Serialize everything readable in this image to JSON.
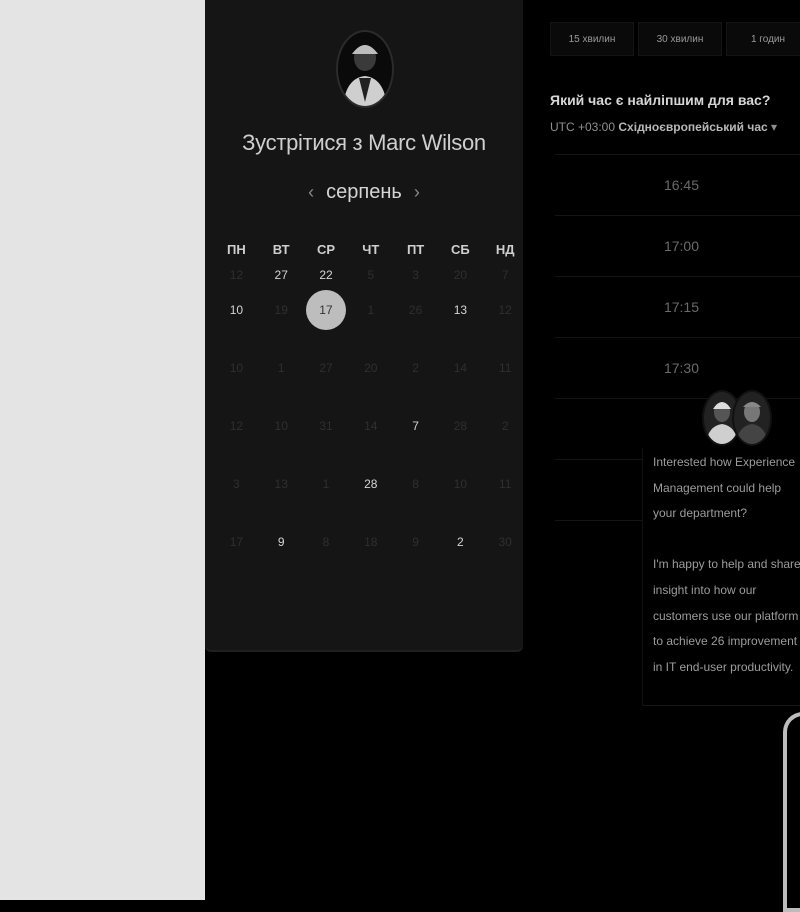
{
  "calendar": {
    "title": "Зустрітися з Marc Wilson",
    "month": "серпень",
    "prev": "‹",
    "next": "›",
    "weekdays": [
      "ПН",
      "ВТ",
      "СР",
      "ЧТ",
      "ПТ",
      "СБ",
      "НД"
    ],
    "weeks": [
      [
        [
          "12",
          false
        ],
        [
          "27",
          true
        ],
        [
          "22",
          true
        ],
        [
          "5",
          false
        ],
        [
          "3",
          false
        ],
        [
          "20",
          false
        ],
        [
          "7",
          false
        ]
      ],
      [
        [
          "10",
          true
        ],
        [
          "19",
          false
        ],
        [
          "17",
          true,
          true
        ],
        [
          "1",
          false
        ],
        [
          "26",
          false
        ],
        [
          "13",
          true
        ],
        [
          "12",
          false
        ]
      ],
      [
        [
          "10",
          false
        ],
        [
          "1",
          false
        ],
        [
          "27",
          false
        ],
        [
          "20",
          false
        ],
        [
          "2",
          false
        ],
        [
          "14",
          false
        ],
        [
          "11",
          false
        ]
      ],
      [
        [
          "12",
          false
        ],
        [
          "10",
          false
        ],
        [
          "31",
          false
        ],
        [
          "14",
          false
        ],
        [
          "7",
          true
        ],
        [
          "28",
          false
        ],
        [
          "2",
          false
        ]
      ],
      [
        [
          "3",
          false
        ],
        [
          "13",
          false
        ],
        [
          "1",
          false
        ],
        [
          "28",
          true
        ],
        [
          "8",
          false
        ],
        [
          "10",
          false
        ],
        [
          "11",
          false
        ]
      ],
      [
        [
          "17",
          false
        ],
        [
          "9",
          true
        ],
        [
          "8",
          false
        ],
        [
          "18",
          false
        ],
        [
          "9",
          false
        ],
        [
          "2",
          true
        ],
        [
          "30",
          false
        ]
      ]
    ]
  },
  "right": {
    "durations": [
      "15 хвилин",
      "30 хвилин",
      "1 годин"
    ],
    "question": "Який час є найліпшим для вас?",
    "tz_prefix": "UTC +03:00",
    "tz_name": "Східноєвропейський час",
    "tz_caret": "▾",
    "slots": [
      "16:45",
      "17:00",
      "17:15",
      "17:30",
      "",
      "",
      ""
    ]
  },
  "chat": {
    "p1": "Interested how Experience Management could help your department?",
    "p2": "I'm happy to help and share insight into how our customers use our platform to achieve 26 improvement in IT end-user productivity."
  }
}
